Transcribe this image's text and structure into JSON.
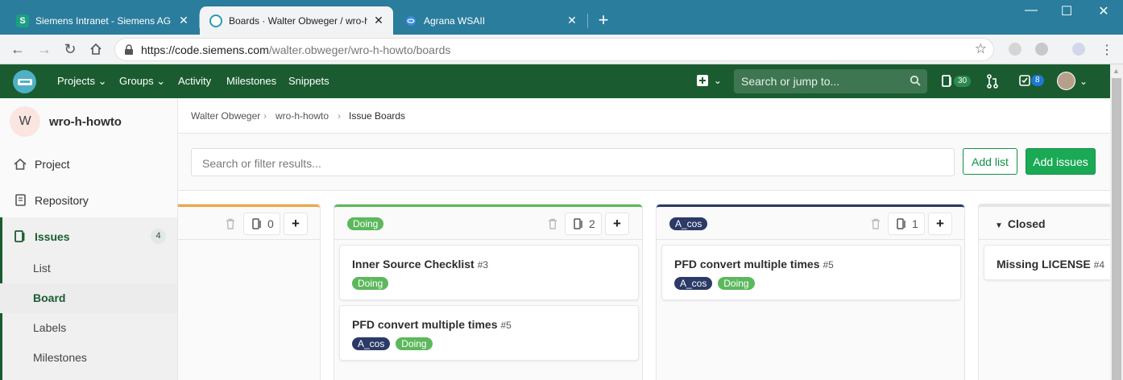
{
  "browser": {
    "tabs": [
      {
        "title": "Siemens Intranet - Siemens AG",
        "favicon": "S"
      },
      {
        "title": "Boards · Walter Obweger / wro-h",
        "favicon": "gitlab"
      },
      {
        "title": "Agrana WSAII",
        "favicon": "globe"
      }
    ],
    "url_host": "https://code.siemens.com",
    "url_path": "/walter.obweger/wro-h-howto/boards"
  },
  "header": {
    "nav": [
      "Projects",
      "Groups",
      "Activity",
      "Milestones",
      "Snippets"
    ],
    "search_placeholder": "Search or jump to...",
    "issues_count": "30",
    "todos_count": "8"
  },
  "sidebar": {
    "avatar_letter": "W",
    "project_name": "wro-h-howto",
    "items": [
      {
        "label": "Project",
        "icon": "home-icon"
      },
      {
        "label": "Repository",
        "icon": "doc-icon"
      },
      {
        "label": "Issues",
        "icon": "issues-icon",
        "count": "4"
      }
    ],
    "issues_sub": [
      "List",
      "Board",
      "Labels",
      "Milestones"
    ]
  },
  "breadcrumb": [
    "Walter Obweger",
    "wro-h-howto",
    "Issue Boards"
  ],
  "filter": {
    "placeholder": "Search or filter results...",
    "add_list": "Add list",
    "add_issues": "Add issues"
  },
  "lists": [
    {
      "title": "",
      "count": "0",
      "color": "#f0a742",
      "cards": []
    },
    {
      "title": "Doing",
      "count": "2",
      "color": "#5cb85c",
      "cards": [
        {
          "title": "Inner Source Checklist",
          "num": "#3",
          "labels": [
            {
              "name": "Doing",
              "color": "#5cb85c"
            }
          ]
        },
        {
          "title": "PFD convert multiple times",
          "num": "#5",
          "labels": [
            {
              "name": "A_cos",
              "color": "#2b3a67"
            },
            {
              "name": "Doing",
              "color": "#5cb85c"
            }
          ]
        }
      ]
    },
    {
      "title": "A_cos",
      "count": "1",
      "color": "#2b3a67",
      "cards": [
        {
          "title": "PFD convert multiple times",
          "num": "#5",
          "labels": [
            {
              "name": "A_cos",
              "color": "#2b3a67"
            },
            {
              "name": "Doing",
              "color": "#5cb85c"
            }
          ]
        }
      ]
    },
    {
      "title": "Closed",
      "count": "",
      "color": "#e5e5e5",
      "cards": [
        {
          "title": "Missing LICENSE",
          "num": "#4",
          "labels": []
        }
      ]
    }
  ],
  "colors": {
    "header": "#1a5c30",
    "accent": "#1aaa55",
    "tabbar": "#2a7d9c"
  }
}
